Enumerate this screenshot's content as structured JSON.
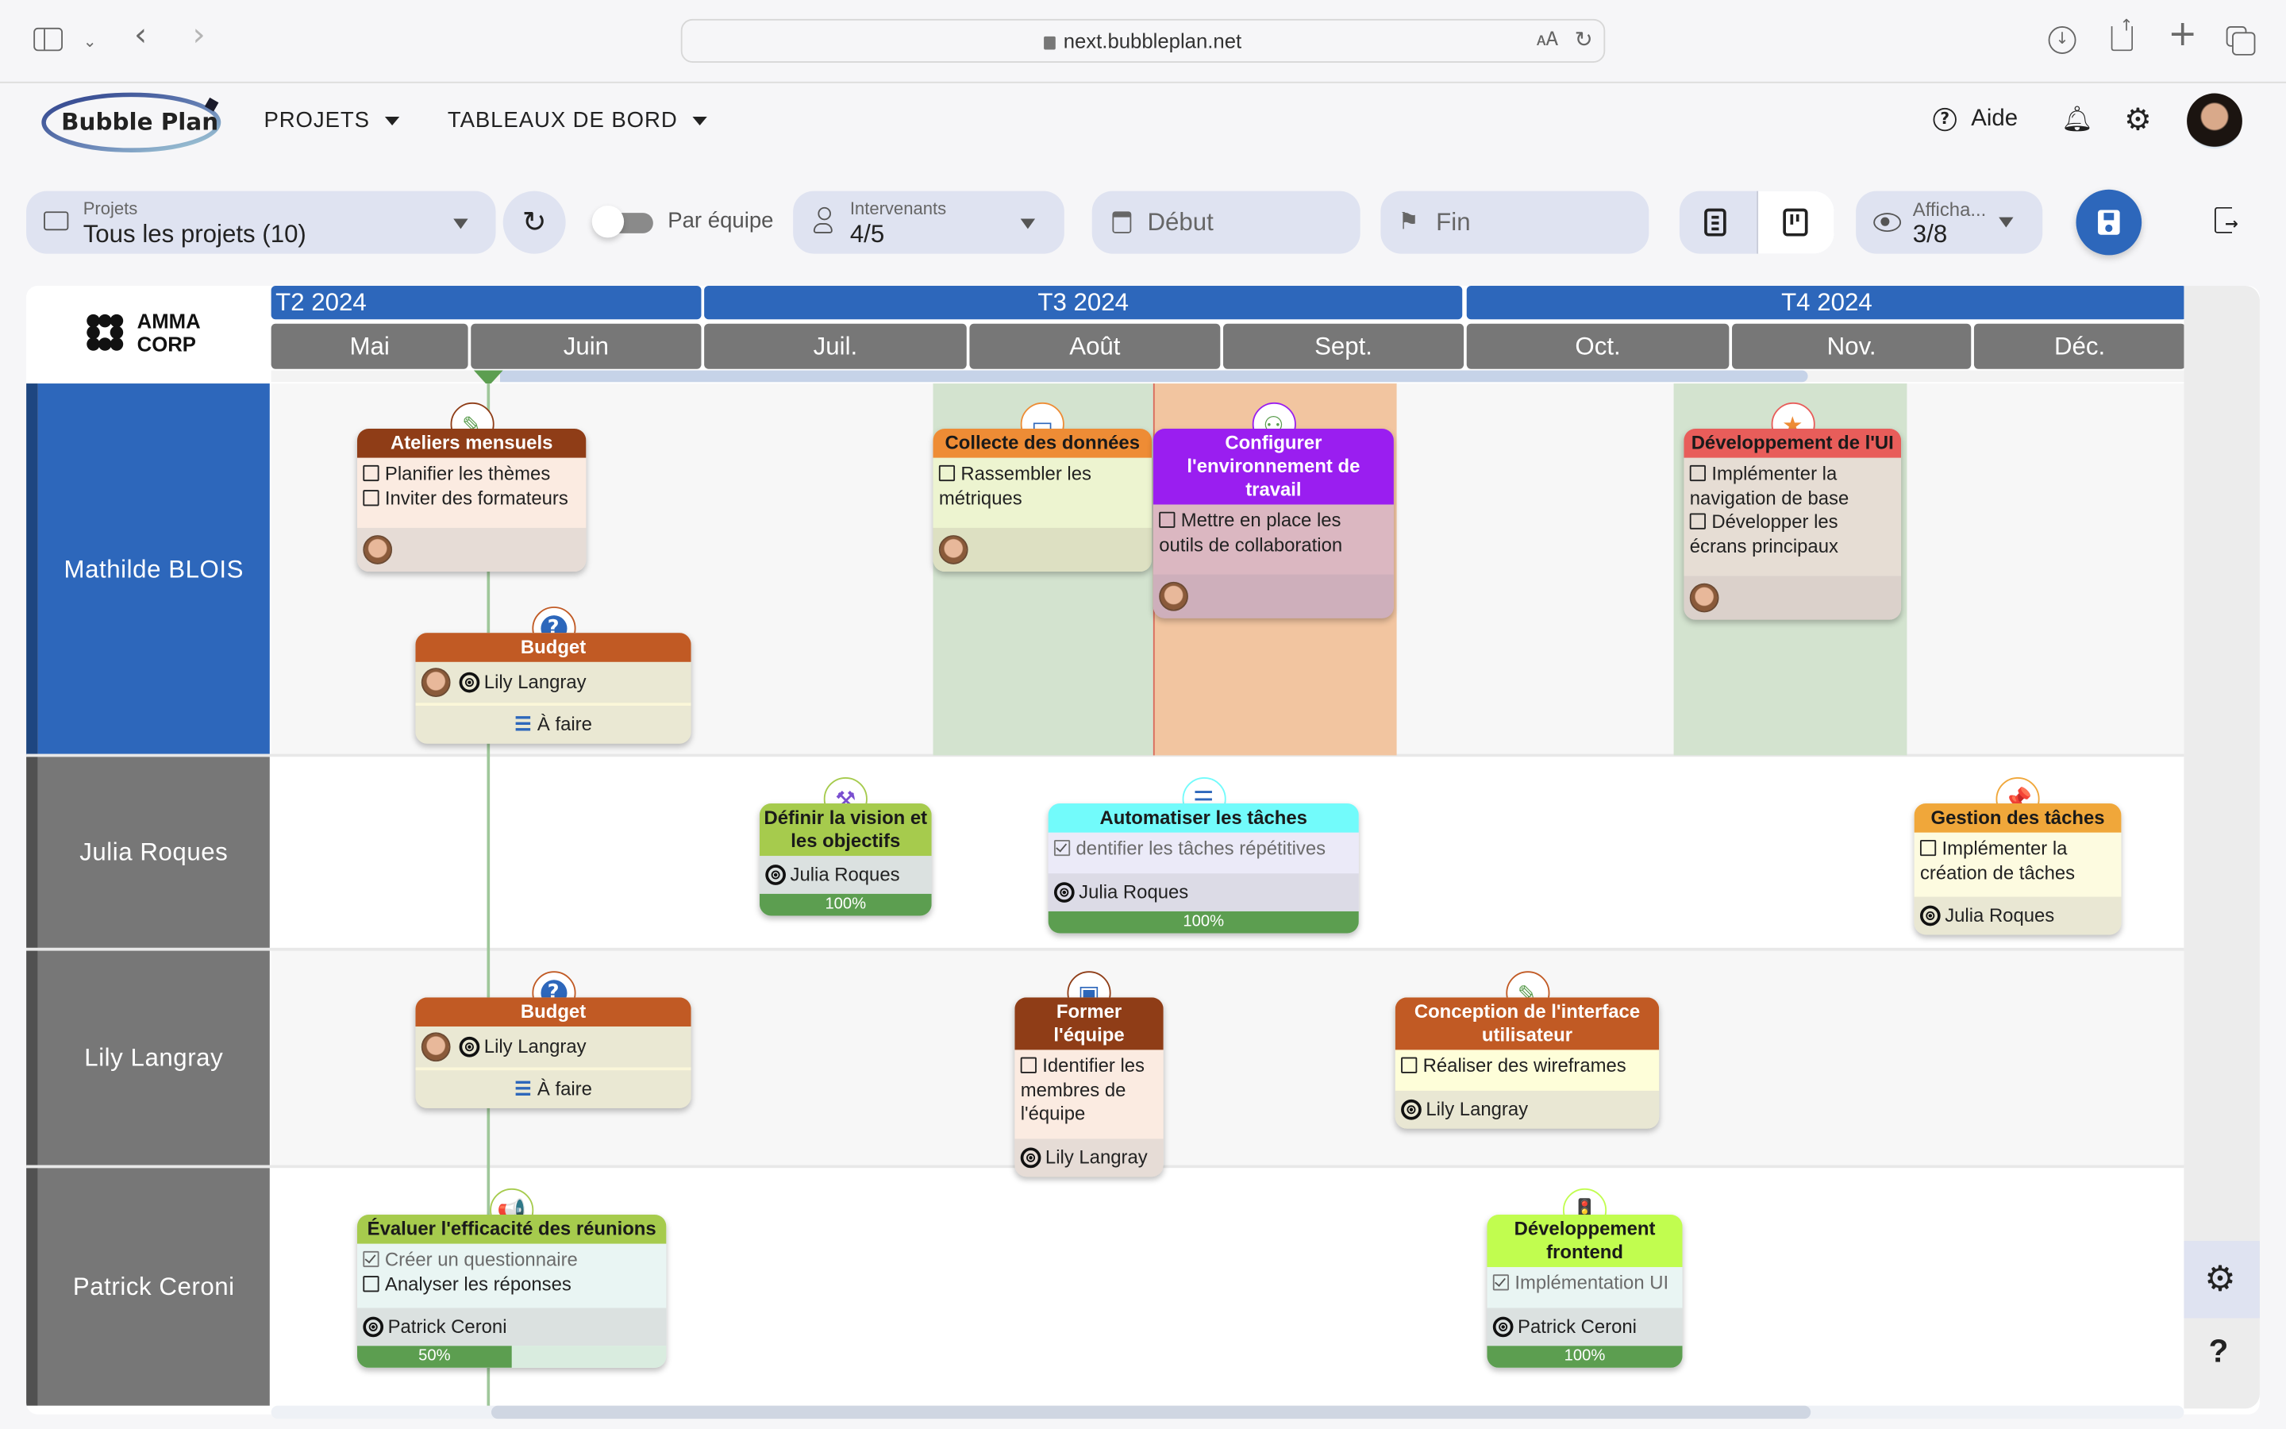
{
  "browser": {
    "url": "next.bubbleplan.net"
  },
  "app": {
    "logo_text": "Bubble Plan",
    "nav": [
      {
        "label": "PROJETS"
      },
      {
        "label": "TABLEAUX DE BORD"
      }
    ],
    "help_label": "Aide"
  },
  "toolbar": {
    "projects_label": "Projets",
    "projects_value": "Tous les projets (10)",
    "team_toggle_label": "Par équipe",
    "team_toggle_on": false,
    "stakeholders_label": "Intervenants",
    "stakeholders_value": "4/5",
    "start_placeholder": "Début",
    "end_placeholder": "Fin",
    "display_label": "Afficha...",
    "display_value": "3/8"
  },
  "gantt": {
    "company": "AMMA\nCORP",
    "company_line1": "AMMA",
    "company_line2": "CORP",
    "quarters": [
      {
        "label": "T2 2024"
      },
      {
        "label": "T3 2024"
      },
      {
        "label": "T4 2024"
      }
    ],
    "months": [
      "Mai",
      "Juin",
      "Juil.",
      "Août",
      "Sept.",
      "Oct.",
      "Nov.",
      "Déc."
    ],
    "lanes": [
      {
        "name": "Mathilde BLOIS",
        "active": true
      },
      {
        "name": "Julia Roques",
        "active": false
      },
      {
        "name": "Lily Langray",
        "active": false
      },
      {
        "name": "Patrick Ceroni",
        "active": false
      }
    ],
    "tasks": [
      {
        "id": "ateliers",
        "title": "Ateliers mensuels",
        "icon": "pencil-ruler-icon",
        "header_color": "#8f3d17",
        "title_color": "#ffffff",
        "body_color": "#fbebe1",
        "foot_color": "#e6dcd6",
        "checklist": [
          {
            "text": "Planifier les thèmes",
            "done": false
          },
          {
            "text": "Inviter des formateurs",
            "done": false
          }
        ],
        "avatar": true,
        "owner": null,
        "status": null,
        "progress": null
      },
      {
        "id": "budget-1",
        "title": "Budget",
        "icon": "question-icon",
        "header_color": "#c15a24",
        "title_color": "#ffffff",
        "body_color": "#eae8d3",
        "foot_color": "#eae8d3",
        "checklist": [],
        "avatar": true,
        "owner": "Lily Langray",
        "status": "À faire",
        "progress": null
      },
      {
        "id": "collecte",
        "title": "Collecte des données",
        "icon": "monitor-icon",
        "header_color": "#ee8c35",
        "title_color": "#1a1a1a",
        "body_color": "#edf4d0",
        "foot_color": "#dde0c2",
        "checklist": [
          {
            "text": "Rassembler les métriques",
            "done": false
          }
        ],
        "avatar": true,
        "owner": null,
        "status": null,
        "progress": null
      },
      {
        "id": "configurer",
        "title": "Configurer l'environnement de travail",
        "icon": "users-icon",
        "header_color": "#9a1ef0",
        "title_color": "#ffffff",
        "body_color": "#dbb7c1",
        "foot_color": "#ceafbb",
        "checklist": [
          {
            "text": "Mettre en place les outils de collaboration",
            "done": false
          }
        ],
        "avatar": true,
        "owner": null,
        "status": null,
        "progress": null
      },
      {
        "id": "dev-ui",
        "title": "Développement de l'UI",
        "icon": "star-icon",
        "header_color": "#e85d5a",
        "title_color": "#1a1a1a",
        "body_color": "#e6ddd4",
        "foot_color": "#dbd1cb",
        "checklist": [
          {
            "text": "Implémenter la navigation de base",
            "done": false
          },
          {
            "text": "Développer les écrans principaux",
            "done": false
          }
        ],
        "avatar": true,
        "owner": null,
        "status": null,
        "progress": null
      },
      {
        "id": "vision",
        "title": "Définir la vision et les objectifs",
        "icon": "tools-icon",
        "header_color": "#a6cb4d",
        "title_color": "#1a1a1a",
        "body_color": "#dbe1e0",
        "foot_color": "#dbe1e0",
        "checklist": [],
        "avatar": false,
        "owner": "Julia Roques",
        "status": null,
        "progress": 100
      },
      {
        "id": "automatiser",
        "title": "Automatiser les tâches",
        "icon": "checklist-icon",
        "header_color": "#72fbfb",
        "title_color": "#1a1a1a",
        "body_color": "#ebeaf8",
        "foot_color": "#dcdbe6",
        "checklist": [
          {
            "text": "dentifier les tâches répétitives",
            "done": true
          }
        ],
        "avatar": false,
        "owner": "Julia Roques",
        "status": null,
        "progress": 100
      },
      {
        "id": "gestion",
        "title": "Gestion des tâches",
        "icon": "pin-icon",
        "header_color": "#f0a73a",
        "title_color": "#1a1a1a",
        "body_color": "#fdfbe0",
        "foot_color": "#e9e7d3",
        "checklist": [
          {
            "text": "Implémenter la création de tâches",
            "done": false
          }
        ],
        "avatar": false,
        "owner": "Julia Roques",
        "status": null,
        "progress": null
      },
      {
        "id": "budget-2",
        "title": "Budget",
        "icon": "question-icon",
        "header_color": "#c15a24",
        "title_color": "#ffffff",
        "body_color": "#eae8d3",
        "foot_color": "#eae8d3",
        "checklist": [],
        "avatar": true,
        "owner": "Lily Langray",
        "status": "À faire",
        "progress": null
      },
      {
        "id": "former",
        "title": "Former l'équipe",
        "icon": "toolbox-icon",
        "header_color": "#8f3d17",
        "title_color": "#ffffff",
        "body_color": "#fbebe1",
        "foot_color": "#e6dcd6",
        "checklist": [
          {
            "text": "Identifier les membres de l'équipe",
            "done": false
          }
        ],
        "avatar": false,
        "owner": "Lily Langray",
        "status": null,
        "progress": null
      },
      {
        "id": "conception",
        "title": "Conception de l'interface utilisateur",
        "icon": "pencil-ruler-icon",
        "header_color": "#c15a24",
        "title_color": "#ffffff",
        "body_color": "#fefed9",
        "foot_color": "#e9e7d3",
        "checklist": [
          {
            "text": "Réaliser des wireframes",
            "done": false
          }
        ],
        "avatar": false,
        "owner": "Lily Langray",
        "status": null,
        "progress": null
      },
      {
        "id": "evaluer",
        "title": "Évaluer l'efficacité des réunions",
        "icon": "megaphone-icon",
        "header_color": "#a6cb4d",
        "title_color": "#1a1a1a",
        "body_color": "#e9f5f3",
        "foot_color": "#dbe1e0",
        "checklist": [
          {
            "text": "Créer un questionnaire",
            "done": true
          },
          {
            "text": "Analyser les réponses",
            "done": false
          }
        ],
        "avatar": false,
        "owner": "Patrick Ceroni",
        "status": null,
        "progress": 50
      },
      {
        "id": "frontend",
        "title": "Développement frontend",
        "icon": "traffic-light-icon",
        "header_color": "#c1fd4f",
        "title_color": "#1a1a1a",
        "body_color": "#e9f5f3",
        "foot_color": "#dbe1e0",
        "checklist": [
          {
            "text": "Implémentation UI",
            "done": true
          }
        ],
        "avatar": false,
        "owner": "Patrick Ceroni",
        "status": null,
        "progress": 100
      }
    ],
    "progress_suffix": "%",
    "colors": {
      "accent": "#2d67bb",
      "lane_inactive": "#777777",
      "progress_green": "#5c9e50",
      "today_marker": "#5c9e50",
      "highlight_green": "#d3e3cf",
      "highlight_orange": "#f2c5a0"
    }
  }
}
